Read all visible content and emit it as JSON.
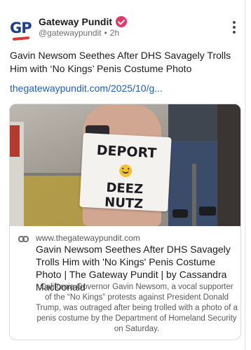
{
  "author": {
    "name": "Gateway Pundit",
    "handle": "@gatewaypundit",
    "separator": "•",
    "time": "2h",
    "avatar_text": "GP"
  },
  "post": {
    "text": "Gavin Newsom Seethes After DHS Savagely Trolls Him with ‘No Kings’ Penis Costume Photo",
    "link": "thegatewaypundit.com/2025/10/g..."
  },
  "preview": {
    "image": {
      "sign_line1": "DEPORT",
      "sign_line2": "DEEZ NUTZ"
    },
    "domain": "www.thegatewaypundit.com",
    "title": "Gavin Newsom Seethes After DHS Savagely Trolls Him with 'No Kings' Penis Costume Photo | The Gateway Pundit | by Cassandra MacDonald",
    "description": "California Governor Gavin Newsom, a vocal supporter of the “No Kings” protests against President Donald Trump, was outraged after being trolled with a photo of a penis costume by the Department of Homeland Security on Saturday."
  },
  "icons": {
    "verified": "verified-badge-icon",
    "more": "more-vertical-icon",
    "link": "link-icon"
  },
  "colors": {
    "link": "#1f5fbf",
    "verified": "#e8356a",
    "logo_blue": "#1f3f8a",
    "logo_red": "#d93a2f"
  }
}
